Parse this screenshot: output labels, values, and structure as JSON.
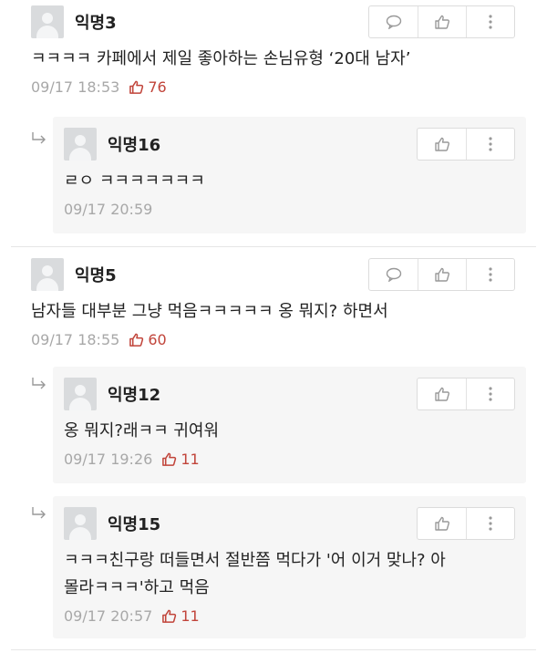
{
  "comments": [
    {
      "author": "익명3",
      "text": "ㅋㅋㅋㅋ 카페에서 제일 좋아하는 손님유형 ‘20대 남자’",
      "time": "09/17 18:53",
      "likes": "76",
      "replies": [
        {
          "author": "익명16",
          "text": "ㄹㅇ ㅋㅋㅋㅋㅋㅋㅋ",
          "time": "09/17 20:59",
          "likes": ""
        }
      ]
    },
    {
      "author": "익명5",
      "text": "남자들 대부분 그냥 먹음ㅋㅋㅋㅋㅋ 옹 뭐지? 하면서",
      "time": "09/17 18:55",
      "likes": "60",
      "replies": [
        {
          "author": "익명12",
          "text": "옹 뭐지?래ㅋㅋ 귀여워",
          "time": "09/17 19:26",
          "likes": "11"
        },
        {
          "author": "익명15",
          "text_line1": "ㅋㅋㅋ친구랑 떠들면서 절반쯤 먹다가 '어 이거 맞나? 아",
          "text_line2": "몰라ㅋㅋㅋ'하고 먹음",
          "time": "09/17 20:57",
          "likes": "11"
        }
      ]
    }
  ],
  "icons": {
    "comment": "speech-bubble-icon",
    "like": "thumbs-up-icon",
    "more": "vertical-dots-icon",
    "reply": "reply-arrow-icon"
  },
  "colors": {
    "like_accent": "#c1443a",
    "meta_gray": "#a8a8a8",
    "reply_bg": "#f6f6f6"
  }
}
